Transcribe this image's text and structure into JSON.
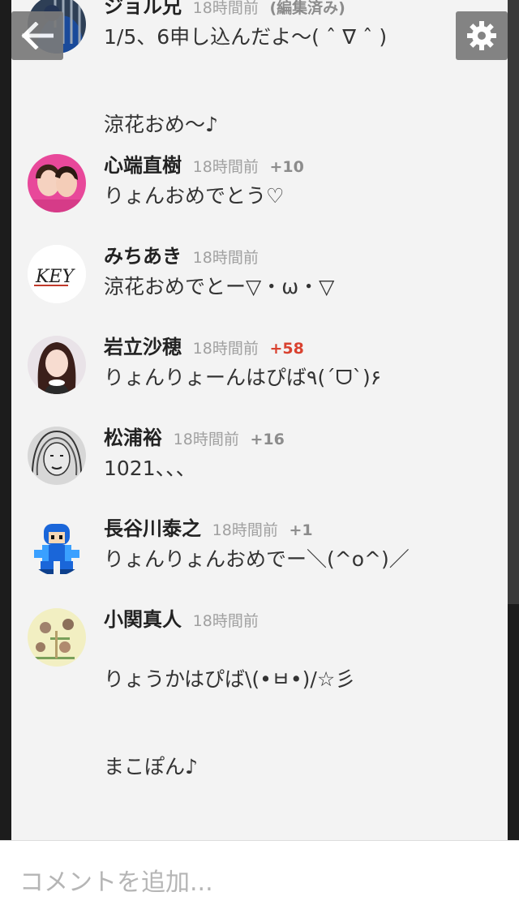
{
  "nav": {
    "back_icon": "arrow-left-icon",
    "settings_icon": "gear-icon"
  },
  "comments": [
    {
      "name": "ジョル兄",
      "time": "18時間前",
      "edited": "(編集済み)",
      "votes": "",
      "text": "1/5、6申し込んだよ〜( ˆ ∇ ˆ )\n\n\n涼花おめ〜♪"
    },
    {
      "name": "心端直樹",
      "time": "18時間前",
      "votes": "+10",
      "text": "りょんおめでとう♡"
    },
    {
      "name": "みちあき",
      "time": "18時間前",
      "votes": "",
      "avatar_text": "KEY",
      "text": "涼花おめでとー▽・ω・▽"
    },
    {
      "name": "岩立沙穂",
      "time": "18時間前",
      "votes": "+58",
      "text": "りょんりょーんはぴば٩(ˊᗜˋ)۶"
    },
    {
      "name": "松浦裕",
      "time": "18時間前",
      "votes": "+16",
      "text": "1021、、、"
    },
    {
      "name": "長谷川泰之",
      "time": "18時間前",
      "votes": "+1",
      "text": "りょんりょんおめでー＼(^o^)／"
    },
    {
      "name": "小関真人",
      "time": "18時間前",
      "votes": "",
      "text": "\nりょうかはぴば\\(•ㅂ•)/☆彡\n\n\nまこぽん♪"
    }
  ],
  "composer": {
    "placeholder": "コメントを追加..."
  }
}
